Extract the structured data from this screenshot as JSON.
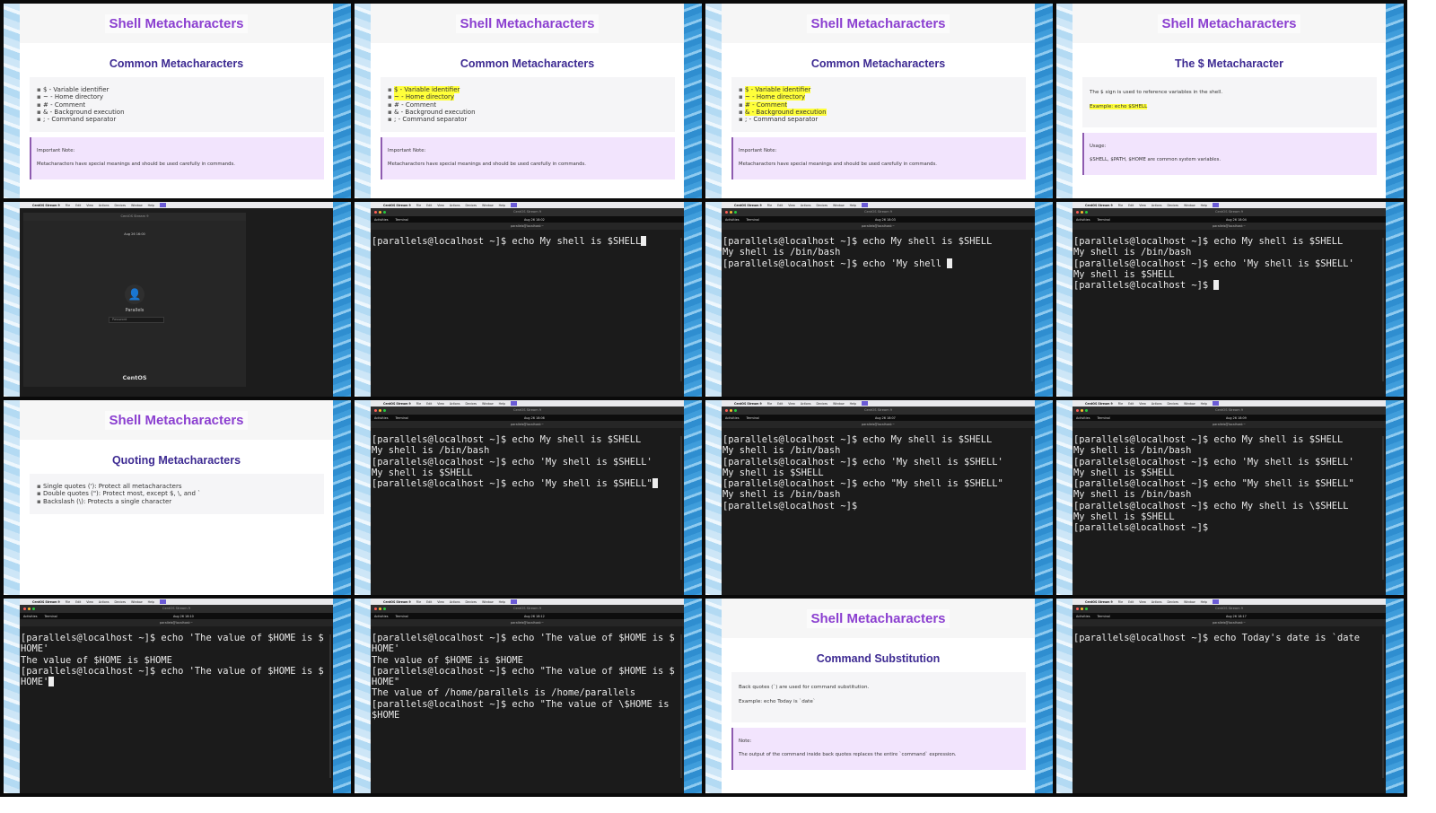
{
  "common": {
    "mac_app": "CentOS Stream 9",
    "mac_menus": [
      "File",
      "Edit",
      "View",
      "Actions",
      "Devices",
      "Window",
      "Help"
    ],
    "window_title": "CentOS Stream 9",
    "activities": "Activities",
    "terminal_label": "Terminal",
    "term_header": "parallels@localhost:~",
    "slide_title": "Shell Metacharacters"
  },
  "cells": [
    {
      "type": "slide",
      "subtitle": "Common Metacharacters",
      "bullets": [
        "$ - Variable identifier",
        "~ - Home directory",
        "# - Comment",
        "& - Background execution",
        "; - Command separator"
      ],
      "highlighted": 0,
      "note_label": "Important Note:",
      "note_text": "Metacharacters have special meanings and should be used carefully in commands."
    },
    {
      "type": "slide",
      "subtitle": "Common Metacharacters",
      "bullets": [
        "$ - Variable identifier",
        "~ - Home directory",
        "# - Comment",
        "& - Background execution",
        "; - Command separator"
      ],
      "highlighted": 2,
      "note_label": "Important Note:",
      "note_text": "Metacharacters have special meanings and should be used carefully in commands."
    },
    {
      "type": "slide",
      "subtitle": "Common Metacharacters",
      "bullets": [
        "$ - Variable identifier",
        "~ - Home directory",
        "# - Comment",
        "& - Background execution",
        "; - Command separator"
      ],
      "highlighted": 4,
      "note_label": "Important Note:",
      "note_text": "Metacharacters have special meanings and should be used carefully in commands."
    },
    {
      "type": "slide",
      "subtitle": "The $ Metacharacter",
      "paragraphs": [
        "The $ sign is used to reference variables in the shell.",
        "Example: echo $SHELL"
      ],
      "highlighted_paragraph": 1,
      "note_label": "Usage:",
      "note_text": "$SHELL, $PATH, $HOME are common system variables."
    },
    {
      "type": "login",
      "date": "Aug 26 16:00",
      "username": "Parallels",
      "password_placeholder": "Password",
      "logo": "CentOS"
    },
    {
      "type": "terminal",
      "date": "Aug 26 18:02",
      "lines": [
        "[parallels@localhost ~]$ echo My shell is $SHELL"
      ],
      "cursor": true
    },
    {
      "type": "terminal",
      "date": "Aug 26 18:03",
      "lines": [
        "[parallels@localhost ~]$ echo My shell is $SHELL",
        "My shell is /bin/bash",
        "[parallels@localhost ~]$ echo 'My shell "
      ],
      "cursor": true
    },
    {
      "type": "terminal",
      "date": "Aug 26 18:04",
      "lines": [
        "[parallels@localhost ~]$ echo My shell is $SHELL",
        "My shell is /bin/bash",
        "[parallels@localhost ~]$ echo 'My shell is $SHELL'",
        "My shell is $SHELL",
        "[parallels@localhost ~]$ "
      ],
      "cursor": true
    },
    {
      "type": "slide",
      "subtitle": "Quoting Metacharacters",
      "bullets": [
        "Single quotes ('): Protect all metacharacters",
        "Double quotes (\"): Protect most, except $, \\, and `",
        "Backslash (\\): Protects a single character"
      ],
      "highlighted": 0
    },
    {
      "type": "terminal",
      "date": "Aug 26 18:06",
      "lines": [
        "[parallels@localhost ~]$ echo My shell is $SHELL",
        "My shell is /bin/bash",
        "[parallels@localhost ~]$ echo 'My shell is $SHELL'",
        "My shell is $SHELL",
        "[parallels@localhost ~]$ echo 'My shell is $SHELL\""
      ],
      "cursor": true
    },
    {
      "type": "terminal",
      "date": "Aug 26 18:07",
      "lines": [
        "[parallels@localhost ~]$ echo My shell is $SHELL",
        "My shell is /bin/bash",
        "[parallels@localhost ~]$ echo 'My shell is $SHELL'",
        "My shell is $SHELL",
        "[parallels@localhost ~]$ echo \"My shell is $SHELL\"",
        "My shell is /bin/bash",
        "[parallels@localhost ~]$ "
      ],
      "cursor": false
    },
    {
      "type": "terminal",
      "date": "Aug 26 18:09",
      "lines": [
        "[parallels@localhost ~]$ echo My shell is $SHELL",
        "My shell is /bin/bash",
        "[parallels@localhost ~]$ echo 'My shell is $SHELL'",
        "My shell is $SHELL",
        "[parallels@localhost ~]$ echo \"My shell is $SHELL\"",
        "My shell is /bin/bash",
        "[parallels@localhost ~]$ echo My shell is \\$SHELL",
        "My shell is $SHELL",
        "[parallels@localhost ~]$ "
      ],
      "cursor": false
    },
    {
      "type": "terminal",
      "date": "Aug 26 18:10",
      "lines": [
        "[parallels@localhost ~]$ echo 'The value of $HOME is $",
        "HOME'",
        "The value of $HOME is $HOME",
        "[parallels@localhost ~]$ echo 'The value of $HOME is $",
        "HOME'"
      ],
      "cursor": true
    },
    {
      "type": "terminal",
      "date": "Aug 26 18:12",
      "lines": [
        "[parallels@localhost ~]$ echo 'The value of $HOME is $",
        "HOME'",
        "The value of $HOME is $HOME",
        "[parallels@localhost ~]$ echo \"The value of $HOME is $",
        "HOME\"",
        "The value of /home/parallels is /home/parallels",
        "[parallels@localhost ~]$ echo \"The value of \\$HOME is",
        "$HOME"
      ],
      "cursor": false
    },
    {
      "type": "slide",
      "subtitle": "Command Substitution",
      "paragraphs": [
        "Back quotes (`) are used for command substitution.",
        "Example: echo Today is `date`"
      ],
      "highlighted_paragraph": -1,
      "note_label": "Note:",
      "note_text": "The output of the command inside back quotes replaces the entire `command` expression."
    },
    {
      "type": "terminal",
      "date": "Aug 26 18:17",
      "lines": [
        "[parallels@localhost ~]$ echo Today's date is `date"
      ],
      "cursor": false
    }
  ],
  "colors": {
    "slide_title": "#8b3fd0",
    "slide_subtitle": "#3d2a92",
    "highlight": "#ffff3a",
    "note_bg": "#f2e4fd",
    "terminal_bg": "#1b1b1b"
  }
}
